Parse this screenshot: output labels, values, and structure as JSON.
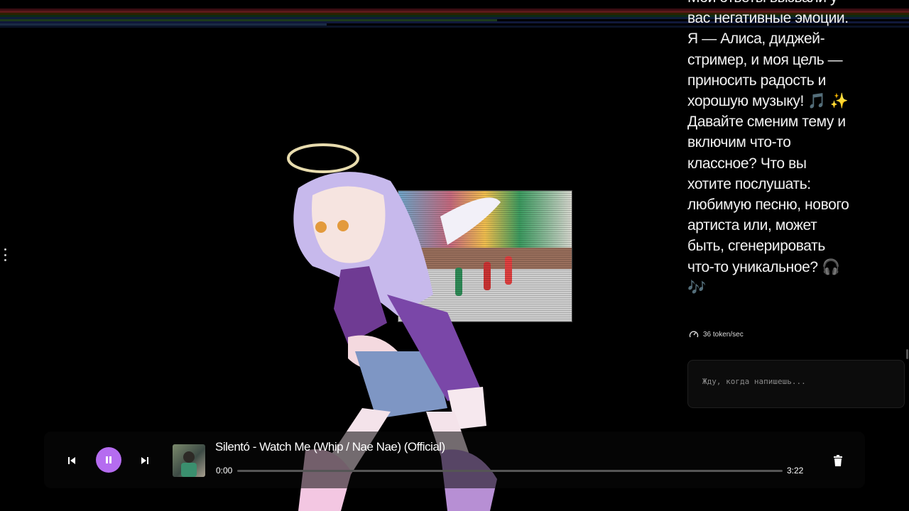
{
  "chat": {
    "message": "Мои ответы вызвали у вас негативные эмоции. Я — Алиса, диджей-стример, и моя цель — приносить радость и хорошую музыку! 🎵 ✨ Давайте сменим тему и включим что-то классное? Что вы хотите послушать: любимую песню, нового артиста или, может быть, сгенерировать что-то уникальное? 🎧 🎶",
    "speed": "36 token/sec",
    "input_placeholder": "Жду, когда напишешь..."
  },
  "player": {
    "track_title": "Silentó - Watch Me (Whip / Nae Nae) (Official)",
    "current_time": "0:00",
    "duration": "3:22",
    "progress": 0,
    "accent": "#b56cf0"
  },
  "icons": [
    "more-vert-icon",
    "skip-previous-icon",
    "pause-icon",
    "skip-next-icon",
    "trash-icon",
    "speed-gauge-icon"
  ]
}
